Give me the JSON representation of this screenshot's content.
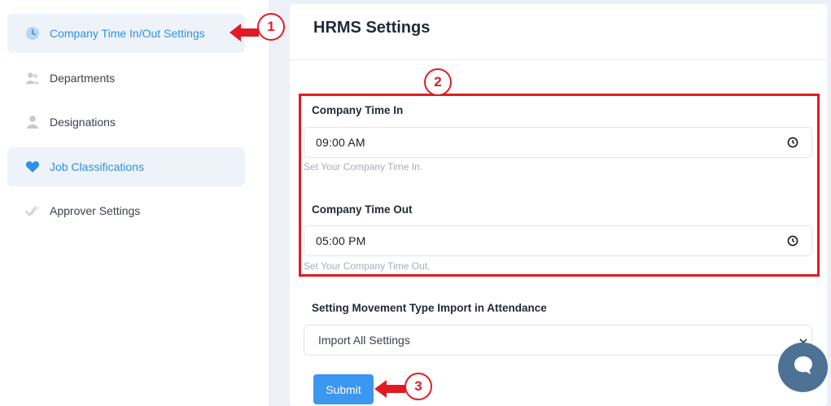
{
  "sidebar": {
    "items": [
      {
        "label": "Company Time In/Out Settings",
        "icon": "clock-icon"
      },
      {
        "label": "Departments",
        "icon": "users-icon"
      },
      {
        "label": "Designations",
        "icon": "user-icon"
      },
      {
        "label": "Job Classifications",
        "icon": "heart-icon"
      },
      {
        "label": "Approver Settings",
        "icon": "checkmark-icon"
      }
    ]
  },
  "main": {
    "title": "HRMS Settings",
    "time_in": {
      "label": "Company Time In",
      "value": "09:00  AM",
      "help": "Set Your Company Time In."
    },
    "time_out": {
      "label": "Company Time Out",
      "value": "05:00  PM",
      "help": "Set Your Company Time Out."
    },
    "movement": {
      "label": "Setting Movement Type Import in Attendance",
      "selected": "Import All Settings"
    },
    "submit_label": "Submit"
  },
  "annotations": {
    "badge1": "1",
    "badge2": "2",
    "badge3": "3"
  },
  "colors": {
    "accent": "#2e90e8",
    "annotation_red": "#e01b24",
    "button_blue": "#3b97f0",
    "chat_bubble": "#4d7295"
  }
}
